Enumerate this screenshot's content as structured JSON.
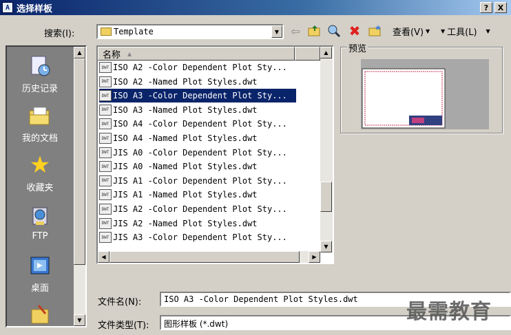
{
  "window": {
    "title": "选择样板",
    "help_btn": "?",
    "close_btn": "X"
  },
  "toolbar": {
    "search_label": "搜索(I):",
    "search_value": "Template",
    "views_label": "查看(V)",
    "tools_label": "工具(L)"
  },
  "places": [
    {
      "label": "历史记录",
      "icon": "history-icon"
    },
    {
      "label": "我的文档",
      "icon": "folder-icon"
    },
    {
      "label": "收藏夹",
      "icon": "star-icon"
    },
    {
      "label": "FTP",
      "icon": "ftp-icon"
    },
    {
      "label": "桌面",
      "icon": "desktop-icon"
    }
  ],
  "filelist": {
    "column_name": "名称",
    "files": [
      "ISO A2 -Color Dependent Plot Sty...",
      "ISO A2 -Named Plot Styles.dwt",
      "ISO A3 -Color Dependent Plot Sty...",
      "ISO A3 -Named Plot Styles.dwt",
      "ISO A4 -Color Dependent Plot Sty...",
      "ISO A4 -Named Plot Styles.dwt",
      "JIS A0 -Color Dependent Plot Sty...",
      "JIS A0 -Named Plot Styles.dwt",
      "JIS A1 -Color Dependent Plot Sty...",
      "JIS A1 -Named Plot Styles.dwt",
      "JIS A2 -Color Dependent Plot Sty...",
      "JIS A2 -Named Plot Styles.dwt",
      "JIS A3 -Color Dependent Plot Sty..."
    ],
    "selected_index": 2,
    "file_icon_text": "DWT"
  },
  "preview": {
    "label": "预览"
  },
  "bottom": {
    "filename_label": "文件名(N):",
    "filename_value": "ISO A3 -Color Dependent Plot Styles.dwt",
    "filetype_label": "文件类型(T):",
    "filetype_value": "图形样板 (*.dwt)"
  },
  "watermark": "最需教育",
  "colors": {
    "selection": "#0a246a",
    "title_gradient_start": "#0a246a",
    "delete_red": "#e02020"
  }
}
